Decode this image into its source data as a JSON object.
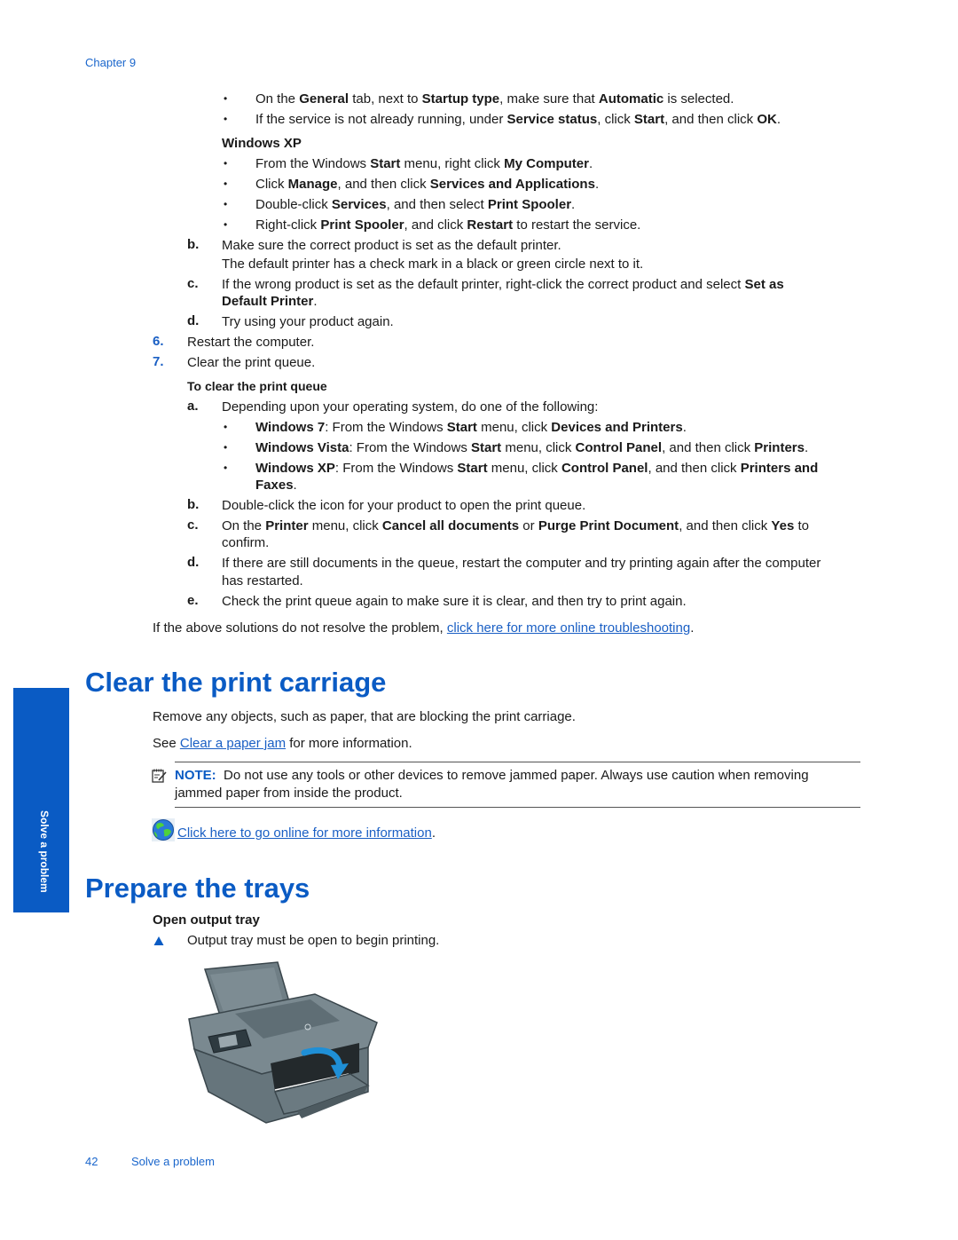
{
  "header": {
    "chapter": "Chapter 9"
  },
  "top_bullets": [
    {
      "parts": [
        "On the ",
        "General",
        " tab, next to ",
        "Startup type",
        ", make sure that ",
        "Automatic",
        " is selected."
      ]
    },
    {
      "parts": [
        "If the service is not already running, under ",
        "Service status",
        ", click ",
        "Start",
        ", and then click ",
        "OK",
        "."
      ]
    }
  ],
  "winxp_heading": "Windows XP",
  "winxp_bullets": [
    {
      "parts": [
        "From the Windows ",
        "Start",
        " menu, right click ",
        "My Computer",
        "."
      ]
    },
    {
      "parts": [
        "Click ",
        "Manage",
        ", and then click ",
        "Services and Applications",
        "."
      ]
    },
    {
      "parts": [
        "Double-click ",
        "Services",
        ", and then select ",
        "Print Spooler",
        "."
      ]
    },
    {
      "parts": [
        "Right-click ",
        "Print Spooler",
        ", and click ",
        "Restart",
        " to restart the service."
      ]
    }
  ],
  "steps_b_to_d": {
    "b": {
      "mark": "b.",
      "line1": "Make sure the correct product is set as the default printer.",
      "line2": "The default printer has a check mark in a black or green circle next to it."
    },
    "c": {
      "mark": "c.",
      "text": "If the wrong product is set as the default printer, right-click the correct product and select ",
      "bold1": "Set as",
      "bold2": "Default Printer",
      "end": "."
    },
    "d": {
      "mark": "d.",
      "text": "Try using your product again."
    }
  },
  "numbered": [
    {
      "num": "6.",
      "text": "Restart the computer."
    },
    {
      "num": "7.",
      "text": "Clear the print queue."
    }
  ],
  "queue": {
    "heading": "To clear the print queue",
    "a": {
      "mark": "a.",
      "text": "Depending upon your operating system, do one of the following:"
    },
    "os_bullets": [
      {
        "parts": [
          "Windows 7",
          ": From the Windows ",
          "Start",
          " menu, click ",
          "Devices and Printers",
          "."
        ]
      },
      {
        "parts": [
          "Windows Vista",
          ": From the Windows ",
          "Start",
          " menu, click ",
          "Control Panel",
          ", and then click ",
          "Printers",
          "."
        ]
      },
      {
        "parts": [
          "Windows XP",
          ": From the Windows ",
          "Start",
          " menu, click ",
          "Control Panel",
          ", and then click ",
          "Printers and"
        ],
        "cont": "Faxes",
        "cont_end": "."
      }
    ],
    "b": {
      "mark": "b.",
      "text": "Double-click the icon for your product to open the print queue."
    },
    "c": {
      "mark": "c.",
      "parts": [
        "On the ",
        "Printer",
        " menu, click ",
        "Cancel all documents",
        " or ",
        "Purge Print Document",
        ", and then click ",
        "Yes",
        " to"
      ],
      "cont": "confirm."
    },
    "d": {
      "mark": "d.",
      "line1": "If there are still documents in the queue, restart the computer and try printing again after the computer",
      "line2": "has restarted."
    },
    "e": {
      "mark": "e.",
      "text": "Check the print queue again to make sure it is clear, and then try to print again."
    }
  },
  "troubleshoot": {
    "prefix": "If the above solutions do not resolve the problem, ",
    "link": "click here for more online troubleshooting",
    "suffix": "."
  },
  "section1": {
    "title": "Clear the print carriage",
    "para1": "Remove any objects, such as paper, that are blocking the print carriage.",
    "see_prefix": "See ",
    "see_link": "Clear a paper jam",
    "see_suffix": " for more information.",
    "note_label": "NOTE:",
    "note_line1": "Do not use any tools or other devices to remove jammed paper. Always use caution when removing",
    "note_line2": "jammed paper from inside the product.",
    "online_link": "Click here to go online for more information",
    "online_suffix": "."
  },
  "section2": {
    "title": "Prepare the trays",
    "subheading": "Open output tray",
    "step_text": "Output tray must be open to begin printing."
  },
  "sidetab": {
    "label": "Solve a problem"
  },
  "footer": {
    "page_number": "42",
    "section": "Solve a problem"
  },
  "colors": {
    "accent": "#0a5bc4",
    "link": "#1a5fc4",
    "text": "#1a1a1a"
  }
}
